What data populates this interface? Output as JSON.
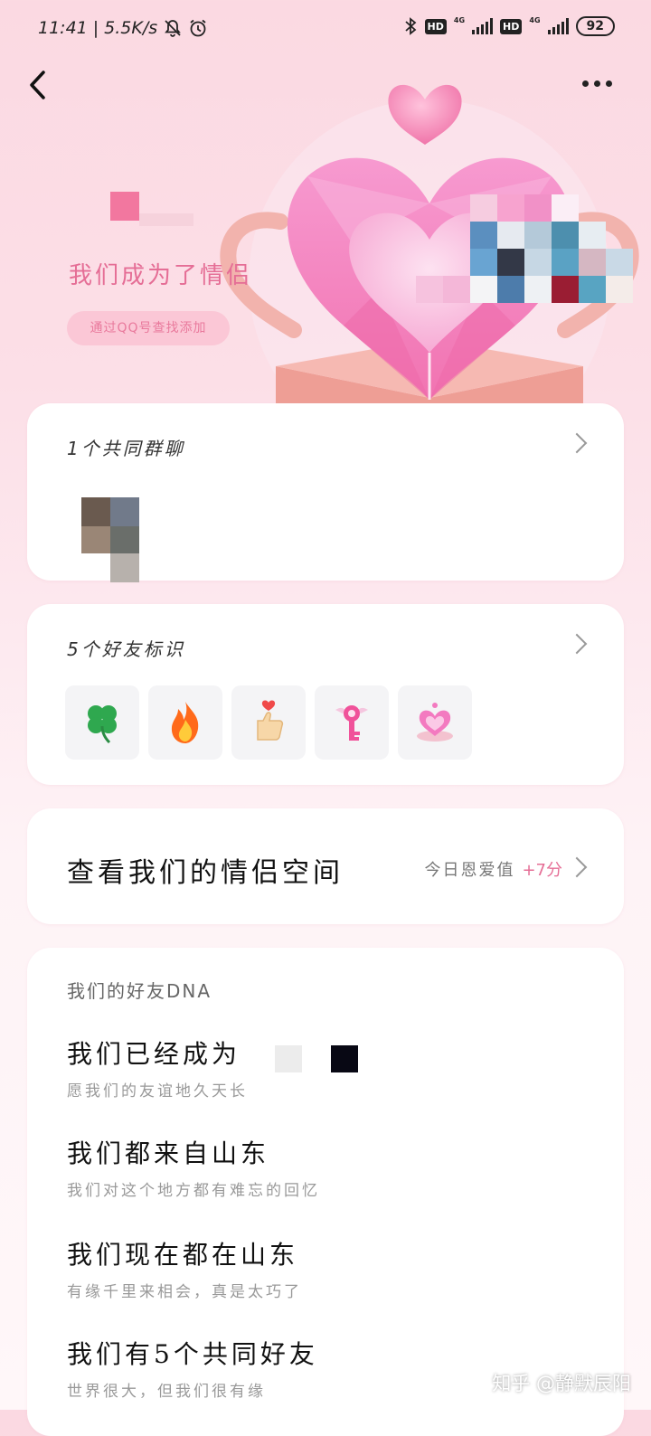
{
  "status_bar": {
    "time": "11:41",
    "speed": "5.5K/s",
    "hd1": "HD",
    "hd2": "HD",
    "net1": "4G",
    "net2": "4G",
    "battery": "92"
  },
  "hero": {
    "title": "我们成为了情侣",
    "pill": "通过QQ号查找添加"
  },
  "common_groups": {
    "header": "1个共同群聊"
  },
  "friend_tags": {
    "header": "5个好友标识",
    "icons": [
      "clover-icon",
      "flame-icon",
      "thumbs-up-heart-icon",
      "winged-key-icon",
      "heart-crown-icon"
    ]
  },
  "couple_space": {
    "title": "查看我们的情侣空间",
    "today_label": "今日恩爱值",
    "today_value": "+7分"
  },
  "friend_dna": {
    "header": "我们的好友DNA",
    "items": [
      {
        "main": "我们已经成为",
        "sub": "愿我们的友谊地久天长"
      },
      {
        "main": "我们都来自山东",
        "sub": "我们对这个地方都有难忘的回忆"
      },
      {
        "main": "我们现在都在山东",
        "sub": "有缘千里来相会，真是太巧了"
      },
      {
        "main": "我们有5个共同好友",
        "sub": "世界很大，但我们很有缘"
      }
    ]
  },
  "watermark": "知乎 @静默辰阳",
  "colors": {
    "accent_pink": "#e56e96",
    "background_pink": "#fbd9e2",
    "card": "#ffffff"
  }
}
